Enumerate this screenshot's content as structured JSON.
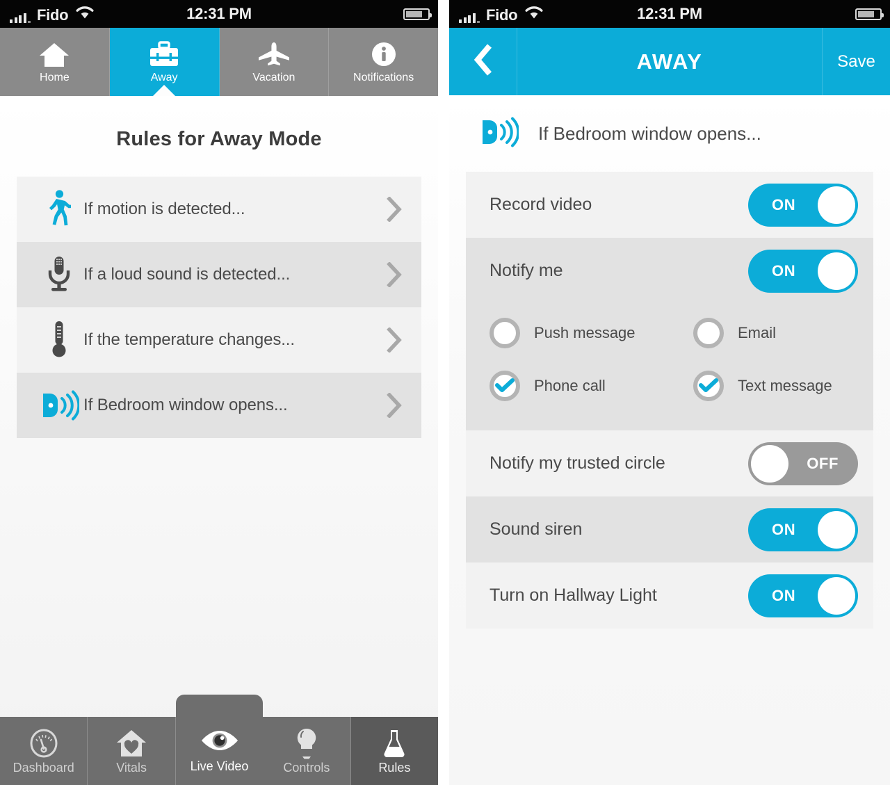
{
  "colors": {
    "accent": "#0cacd8",
    "nav_gray": "#8a8a8a",
    "tabbar_gray": "#6e6e6e",
    "tabbar_active_dark": "#5a5a5a",
    "row_light": "#f2f2f2",
    "row_dark": "#e2e2e2",
    "text_dark": "#4a4a4a",
    "toggle_off_gray": "#9a9a9a",
    "status_bar": "#050505"
  },
  "status_bar": {
    "carrier": "Fido",
    "time": "12:31 PM",
    "signal_icon": "signal-bars-icon",
    "wifi_icon": "wifi-icon",
    "battery_icon": "battery-icon"
  },
  "left_screen": {
    "mode_tabs": [
      {
        "label": "Home",
        "icon": "house-icon",
        "active": false
      },
      {
        "label": "Away",
        "icon": "briefcase-icon",
        "active": true
      },
      {
        "label": "Vacation",
        "icon": "airplane-icon",
        "active": false
      },
      {
        "label": "Notifications",
        "icon": "info-circle-icon",
        "active": false
      }
    ],
    "page_title": "Rules for Away Mode",
    "rules": [
      {
        "label": "If motion is detected...",
        "icon": "walking-person-icon",
        "icon_color": "#0cacd8",
        "chevron": "chevron-right-icon"
      },
      {
        "label": "If a loud sound is detected...",
        "icon": "microphone-icon",
        "icon_color": "#4a4a4a",
        "chevron": "chevron-right-icon"
      },
      {
        "label": "If the temperature changes...",
        "icon": "thermometer-icon",
        "icon_color": "#4a4a4a",
        "chevron": "chevron-right-icon"
      },
      {
        "label": "If Bedroom window opens...",
        "icon": "window-sensor-icon",
        "icon_color": "#0cacd8",
        "chevron": "chevron-right-icon"
      }
    ],
    "bottom_tabs": [
      {
        "label": "Dashboard",
        "icon": "gauge-icon",
        "active": false
      },
      {
        "label": "Vitals",
        "icon": "house-heart-icon",
        "active": false
      },
      {
        "label": "Live Video",
        "icon": "eye-icon",
        "active": true
      },
      {
        "label": "Controls",
        "icon": "lightbulb-icon",
        "active": false
      },
      {
        "label": "Rules",
        "icon": "flask-icon",
        "active": false
      }
    ]
  },
  "right_screen": {
    "nav": {
      "back_icon": "chevron-left-icon",
      "title": "AWAY",
      "save_label": "Save"
    },
    "rule_header": {
      "icon": "window-sensor-icon",
      "label": "If Bedroom window opens..."
    },
    "settings": [
      {
        "label": "Record video",
        "state": "ON"
      },
      {
        "label": "Notify me",
        "state": "ON"
      },
      {
        "label": "Notify my trusted circle",
        "state": "OFF"
      },
      {
        "label": "Sound siren",
        "state": "ON"
      },
      {
        "label": "Turn on Hallway Light",
        "state": "ON"
      }
    ],
    "notify_options": [
      {
        "label": "Push message",
        "checked": false,
        "icon": "radio-circle-icon"
      },
      {
        "label": "Email",
        "checked": false,
        "icon": "radio-circle-icon"
      },
      {
        "label": "Phone call",
        "checked": true,
        "icon": "check-circle-icon"
      },
      {
        "label": "Text message",
        "checked": true,
        "icon": "check-circle-icon"
      }
    ]
  }
}
